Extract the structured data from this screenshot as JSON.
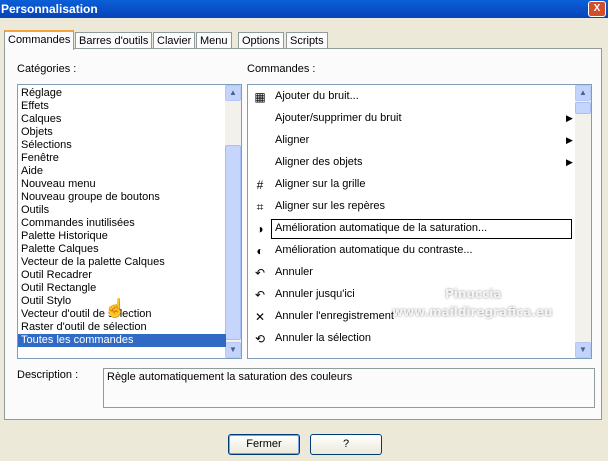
{
  "window": {
    "title": "Personnalisation",
    "close_label": "X"
  },
  "tabs": [
    {
      "label": "Commandes",
      "active": true
    },
    {
      "label": "Barres d'outils",
      "active": false
    },
    {
      "label": "Clavier",
      "active": false
    },
    {
      "label": "Menu",
      "active": false
    },
    {
      "label": "Options",
      "active": false
    },
    {
      "label": "Scripts",
      "active": false
    }
  ],
  "categories": {
    "label": "Catégories :",
    "items": [
      "Réglage",
      "Effets",
      "Calques",
      "Objets",
      "Sélections",
      "Fenêtre",
      "Aide",
      "Nouveau menu",
      "Nouveau groupe de boutons",
      "Outils",
      "Commandes inutilisées",
      "Palette Historique",
      "Palette Calques",
      "Vecteur de la palette Calques",
      "Outil Recadrer",
      "Outil Rectangle",
      "Outil Stylo",
      "Vecteur d'outil de sélection",
      "Raster d'outil de sélection",
      "Toutes les commandes"
    ],
    "selected": "Toutes les commandes"
  },
  "commands": {
    "label": "Commandes :",
    "items": [
      {
        "label": "Ajouter du bruit...",
        "icon": "noise-icon",
        "glyph": "▦",
        "submenu": false
      },
      {
        "label": "Ajouter/supprimer du bruit",
        "icon": "",
        "glyph": "",
        "submenu": true
      },
      {
        "label": "Aligner",
        "icon": "",
        "glyph": "",
        "submenu": true
      },
      {
        "label": "Aligner des objets",
        "icon": "",
        "glyph": "",
        "submenu": true
      },
      {
        "label": "Aligner sur la grille",
        "icon": "grid-icon",
        "glyph": "#",
        "submenu": false
      },
      {
        "label": "Aligner sur les repères",
        "icon": "guides-icon",
        "glyph": "⌗",
        "submenu": false
      },
      {
        "label": "Amélioration automatique de la saturation...",
        "icon": "saturation-icon",
        "glyph": "◑",
        "submenu": false
      },
      {
        "label": "Amélioration automatique du contraste...",
        "icon": "contrast-icon",
        "glyph": "◐",
        "submenu": false
      },
      {
        "label": "Annuler",
        "icon": "undo-icon",
        "glyph": "↶",
        "submenu": false
      },
      {
        "label": "Annuler jusqu'ici",
        "icon": "undo-to-here-icon",
        "glyph": "↶",
        "submenu": false
      },
      {
        "label": "Annuler l'enregistrement",
        "icon": "cancel-recording-icon",
        "glyph": "✕",
        "submenu": false
      },
      {
        "label": "Annuler la sélection",
        "icon": "deselect-icon",
        "glyph": "⟲",
        "submenu": false
      }
    ],
    "focused": "Amélioration automatique de la saturation..."
  },
  "description": {
    "label": "Description :",
    "text": "Règle automatiquement la saturation des couleurs"
  },
  "buttons": {
    "close": "Fermer",
    "help": "?"
  },
  "watermark": {
    "line1": "Pinuccia",
    "line2": "www.maildiregrafica.eu"
  },
  "colors": {
    "title_bar": "#0842b8",
    "selection": "#316ac5",
    "active_tab_accent": "#f5a33c"
  }
}
